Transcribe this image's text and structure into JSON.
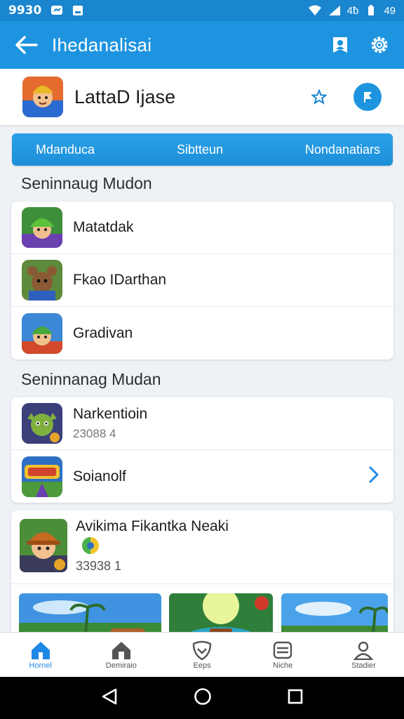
{
  "status_bar": {
    "time": "9930",
    "right_text": "4ƀ",
    "battery_text": "49"
  },
  "app_bar": {
    "title": "Ihedanalisai"
  },
  "header": {
    "app_title": "LattaD Ijase"
  },
  "tabs": [
    "Mdanduca",
    "Sibtteun",
    "Nondanatiars"
  ],
  "section1": {
    "title": "Seninnaug Mudon",
    "items": [
      {
        "label": "Matatdak",
        "icon": "elf-hero-avatar"
      },
      {
        "label": "Fkao IDarthan",
        "icon": "bear-warrior-avatar"
      },
      {
        "label": "Gradivan",
        "icon": "green-helmet-avatar"
      }
    ]
  },
  "section2": {
    "title": "Seninnanag Mudan",
    "items": [
      {
        "label": "Narkentioin",
        "sub": "23088 4",
        "icon": "goblin-avatar"
      },
      {
        "label": "Soianolf",
        "icon": "game-logo-badge"
      }
    ]
  },
  "feature": {
    "title": "Avikima Fikantka Neaki",
    "count": "33938 1",
    "icon": "adventurer-avatar"
  },
  "bottom_nav": [
    {
      "label": "Hornel",
      "icon": "home-icon",
      "active": true
    },
    {
      "label": "Demiraio",
      "icon": "store-icon",
      "active": false
    },
    {
      "label": "Eeps",
      "icon": "heart-shield-icon",
      "active": false
    },
    {
      "label": "Niche",
      "icon": "card-icon",
      "active": false
    },
    {
      "label": "Stadier",
      "icon": "profile-icon",
      "active": false
    }
  ],
  "colors": {
    "primary": "#1e94e0",
    "status": "#1a86cf",
    "active_nav": "#1e88e5"
  }
}
